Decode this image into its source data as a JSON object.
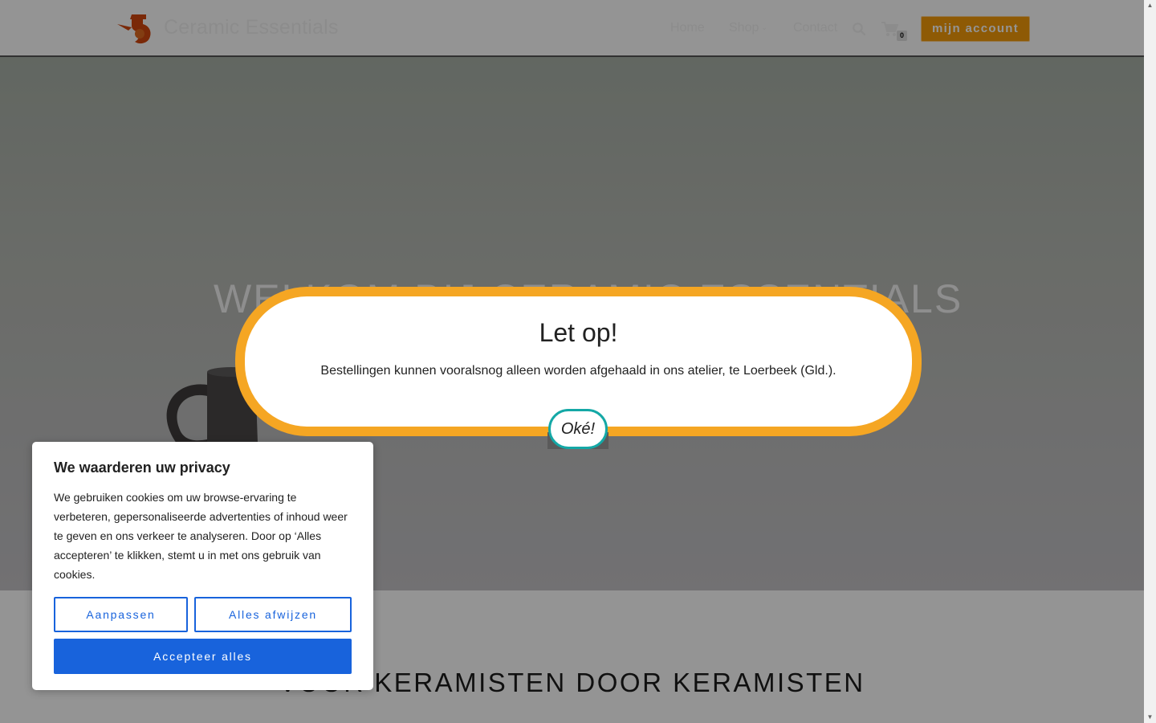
{
  "header": {
    "site_title": "Ceramic Essentials",
    "nav": {
      "home": "Home",
      "shop": "Shop",
      "contact": "Contact"
    },
    "cart_count": "0",
    "account_button": "mijn account"
  },
  "hero": {
    "title": "WELKOM BIJ CERAMIC ESSENTIALS"
  },
  "section2": {
    "title": "VOOR KERAMISTEN DOOR KERAMISTEN"
  },
  "notice": {
    "title": "Let op!",
    "text": "Bestellingen kunnen vooralsnog alleen worden afgehaald in ons atelier, te Loerbeek (Gld.).",
    "ok_button": "Oké!"
  },
  "cookie": {
    "title": "We waarderen uw privacy",
    "text": "We gebruiken cookies om uw browse-ervaring te verbeteren, gepersonaliseerde advertenties of inhoud weer te geven en ons verkeer te analyseren. Door op ‘Alles accepteren’ te klikken, stemt u in met ons gebruik van cookies.",
    "customize": "Aanpassen",
    "reject": "Alles afwijzen",
    "accept": "Accepteer alles"
  },
  "colors": {
    "accent_orange": "#f49b0a",
    "modal_border": "#f5a623",
    "ok_border": "#14a8a6",
    "cookie_blue": "#1863dc"
  },
  "icons": [
    "logo-icon",
    "chevron-down-icon",
    "search-icon",
    "cart-icon",
    "scroll-up-icon",
    "scroll-down-icon"
  ]
}
